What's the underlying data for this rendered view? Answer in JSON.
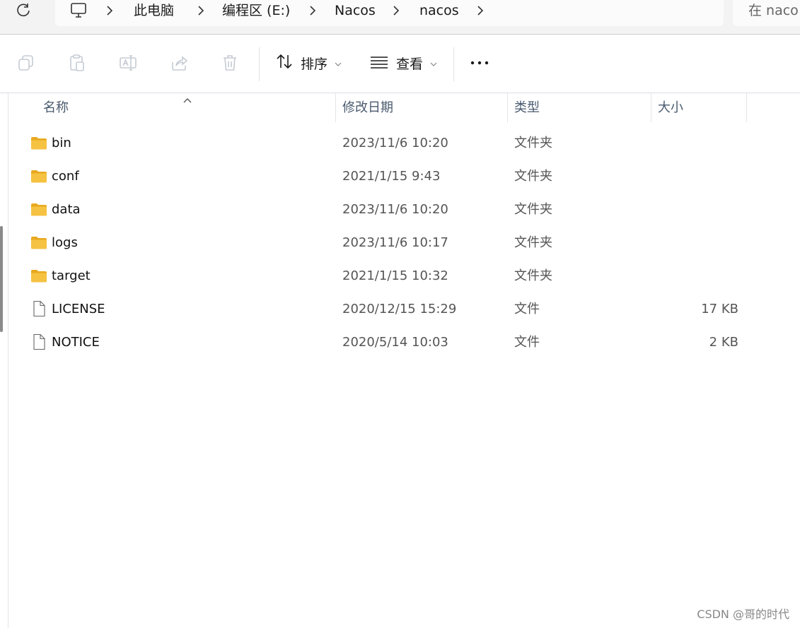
{
  "address_bar": {
    "breadcrumb": [
      "此电脑",
      "编程区 (E:)",
      "Nacos",
      "nacos"
    ],
    "search_placeholder": "在 naco"
  },
  "toolbar": {
    "sort_label": "排序",
    "view_label": "查看",
    "more_label": "•••",
    "icons": [
      "copy-icon",
      "paste-icon",
      "rename-icon",
      "share-icon",
      "delete-icon",
      "sort-icon",
      "view-icon",
      "more-icon"
    ]
  },
  "columns": {
    "name": "名称",
    "modified": "修改日期",
    "type": "类型",
    "size": "大小"
  },
  "files": [
    {
      "name": "bin",
      "modified": "2023/11/6 10:20",
      "type": "文件夹",
      "size": "",
      "icon": "folder-icon"
    },
    {
      "name": "conf",
      "modified": "2021/1/15 9:43",
      "type": "文件夹",
      "size": "",
      "icon": "folder-icon"
    },
    {
      "name": "data",
      "modified": "2023/11/6 10:20",
      "type": "文件夹",
      "size": "",
      "icon": "folder-icon"
    },
    {
      "name": "logs",
      "modified": "2023/11/6 10:17",
      "type": "文件夹",
      "size": "",
      "icon": "folder-icon"
    },
    {
      "name": "target",
      "modified": "2021/1/15 10:32",
      "type": "文件夹",
      "size": "",
      "icon": "folder-icon"
    },
    {
      "name": "LICENSE",
      "modified": "2020/12/15 15:29",
      "type": "文件",
      "size": "17 KB",
      "icon": "file-icon"
    },
    {
      "name": "NOTICE",
      "modified": "2020/5/14 10:03",
      "type": "文件",
      "size": "2 KB",
      "icon": "file-icon"
    }
  ],
  "watermark": "CSDN @哥的时代",
  "colors": {
    "folder": "#f5c242",
    "folder_back": "#e8a920",
    "toolbar_icon_disabled": "#c5cbd3"
  }
}
